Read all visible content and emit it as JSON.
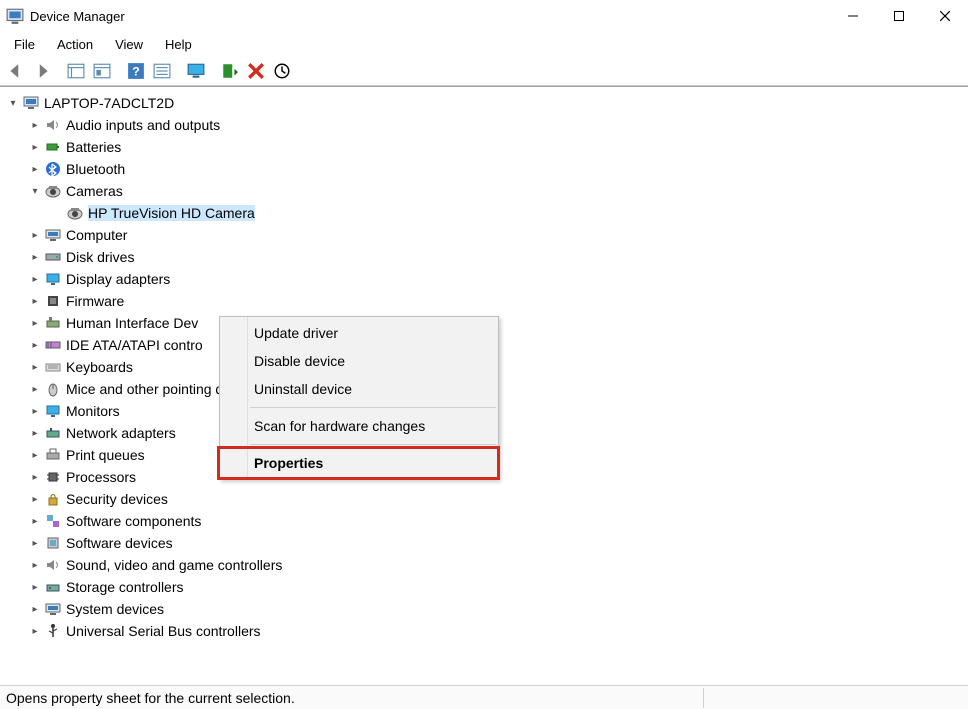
{
  "window": {
    "title": "Device Manager"
  },
  "menu": {
    "items": [
      "File",
      "Action",
      "View",
      "Help"
    ]
  },
  "toolbar_icons": [
    "back",
    "forward",
    "show-hidden",
    "properties-pane",
    "help",
    "find",
    "monitor",
    "scan",
    "delete",
    "update"
  ],
  "tree": {
    "root": {
      "label": "LAPTOP-7ADCLT2D",
      "expanded": true
    },
    "children": [
      {
        "label": "Audio inputs and outputs",
        "icon": "speaker",
        "expanded": false
      },
      {
        "label": "Batteries",
        "icon": "battery",
        "expanded": false
      },
      {
        "label": "Bluetooth",
        "icon": "bluetooth",
        "expanded": false
      },
      {
        "label": "Cameras",
        "icon": "camera",
        "expanded": true,
        "children": [
          {
            "label": "HP TrueVision HD Camera",
            "icon": "camera",
            "selected": true
          }
        ]
      },
      {
        "label": "Computer",
        "icon": "computer",
        "expanded": false
      },
      {
        "label": "Disk drives",
        "icon": "disk",
        "expanded": false
      },
      {
        "label": "Display adapters",
        "icon": "display",
        "expanded": false
      },
      {
        "label": "Firmware",
        "icon": "firmware",
        "expanded": false
      },
      {
        "label": "Human Interface Devices",
        "icon": "hid",
        "truncated": "Human Interface Dev",
        "expanded": false
      },
      {
        "label": "IDE ATA/ATAPI controllers",
        "icon": "ide",
        "truncated": "IDE ATA/ATAPI contro",
        "expanded": false
      },
      {
        "label": "Keyboards",
        "icon": "keyboard",
        "expanded": false
      },
      {
        "label": "Mice and other pointing devices",
        "icon": "mouse",
        "expanded": false
      },
      {
        "label": "Monitors",
        "icon": "monitor",
        "expanded": false
      },
      {
        "label": "Network adapters",
        "icon": "network",
        "expanded": false
      },
      {
        "label": "Print queues",
        "icon": "printer",
        "expanded": false
      },
      {
        "label": "Processors",
        "icon": "cpu",
        "expanded": false
      },
      {
        "label": "Security devices",
        "icon": "security",
        "expanded": false
      },
      {
        "label": "Software components",
        "icon": "software-comp",
        "expanded": false
      },
      {
        "label": "Software devices",
        "icon": "software-dev",
        "expanded": false
      },
      {
        "label": "Sound, video and game controllers",
        "icon": "sound",
        "expanded": false
      },
      {
        "label": "Storage controllers",
        "icon": "storage",
        "expanded": false
      },
      {
        "label": "System devices",
        "icon": "system",
        "expanded": false
      },
      {
        "label": "Universal Serial Bus controllers",
        "icon": "usb",
        "expanded": false
      }
    ]
  },
  "context_menu": {
    "items": [
      {
        "label": "Update driver"
      },
      {
        "label": "Disable device"
      },
      {
        "label": "Uninstall device"
      },
      {
        "separator": true
      },
      {
        "label": "Scan for hardware changes"
      },
      {
        "separator": true
      },
      {
        "label": "Properties",
        "bold": true,
        "highlighted": true
      }
    ]
  },
  "statusbar": {
    "text": "Opens property sheet for the current selection."
  }
}
